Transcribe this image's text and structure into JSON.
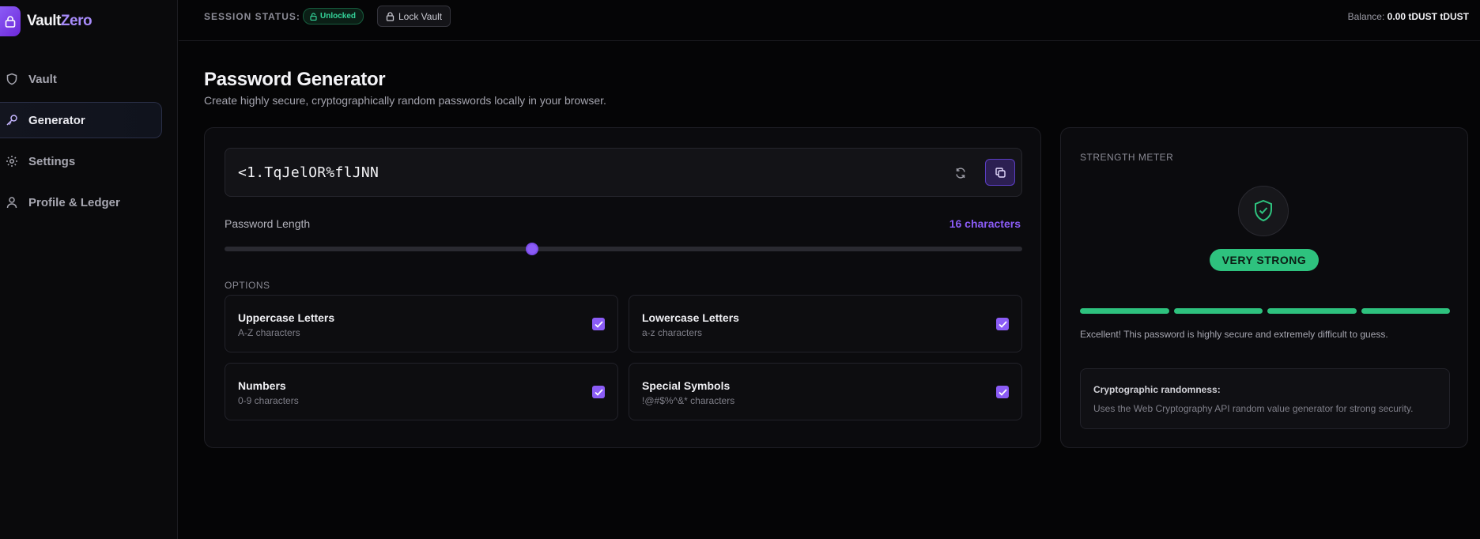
{
  "brand": {
    "part1": "Vault",
    "part2": "Zero"
  },
  "sidebar": {
    "items": [
      {
        "label": "Vault",
        "icon": "shield-icon",
        "active": false
      },
      {
        "label": "Generator",
        "icon": "key-icon",
        "active": true
      },
      {
        "label": "Settings",
        "icon": "gear-icon",
        "active": false
      },
      {
        "label": "Profile & Ledger",
        "icon": "user-icon",
        "active": false
      }
    ]
  },
  "topbar": {
    "session_label": "SESSION STATUS:",
    "status_badge": "Unlocked",
    "lock_button": "Lock Vault",
    "balance_label": "Balance:",
    "balance_value": "0.00 tDUST tDUST"
  },
  "page": {
    "title": "Password Generator",
    "subtitle": "Create highly secure, cryptographically random passwords locally in your browser."
  },
  "generator": {
    "password": "<1.TqJelOR%flJNN",
    "length_label": "Password Length",
    "length_value": "16 characters",
    "slider_fraction": 0.386,
    "options_label": "OPTIONS",
    "options": [
      {
        "title": "Uppercase Letters",
        "sub": "A-Z characters",
        "checked": true
      },
      {
        "title": "Lowercase Letters",
        "sub": "a-z characters",
        "checked": true
      },
      {
        "title": "Numbers",
        "sub": "0-9 characters",
        "checked": true
      },
      {
        "title": "Special Symbols",
        "sub": "!@#$%^&* characters",
        "checked": true
      }
    ]
  },
  "strength": {
    "label": "STRENGTH METER",
    "badge": "VERY STRONG",
    "filled_segments": 4,
    "total_segments": 4,
    "message": "Excellent! This password is highly secure and extremely difficult to guess.",
    "info_title": "Cryptographic randomness:",
    "info_desc": "Uses the Web Cryptography API random value generator for strong security."
  },
  "colors": {
    "accent": "#8b5cf6",
    "success": "#2ec27e",
    "background": "#050506"
  }
}
